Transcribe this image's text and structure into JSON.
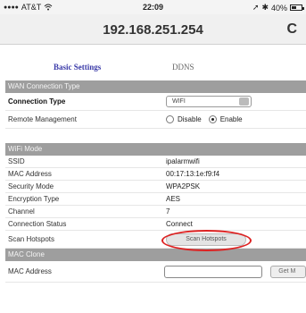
{
  "status_bar": {
    "signal": "●●●●",
    "carrier": "AT&T",
    "wifi_icon": "wifi-icon",
    "time": "22:09",
    "battery": "40%"
  },
  "address_bar": {
    "url": "192.168.251.254",
    "reload_icon": "reload-icon"
  },
  "tabs": [
    {
      "label": "Basic Settings"
    },
    {
      "label": "DDNS"
    }
  ],
  "wan": {
    "section_title": "WAN Connection Type",
    "connection_type_label": "Connection Type",
    "connection_type_value": "WIFI",
    "remote_label": "Remote Management",
    "remote_options": [
      "Disable",
      "Enable"
    ],
    "remote_selected": "Enable"
  },
  "wifi": {
    "section_title": "WiFi Mode",
    "rows": [
      {
        "label": "SSID",
        "value": "ipalarmwifi"
      },
      {
        "label": "MAC Address",
        "value": "00:17:13:1e:f9:f4"
      },
      {
        "label": "Security Mode",
        "value": "WPA2PSK"
      },
      {
        "label": "Encryption Type",
        "value": "AES"
      },
      {
        "label": "Channel",
        "value": "7"
      },
      {
        "label": "Connection Status",
        "value": "Connect"
      }
    ],
    "scan_label": "Scan Hotspots",
    "scan_button": "Scan Hotspots"
  },
  "mac_clone": {
    "section_title": "MAC Clone",
    "label": "MAC Address",
    "input_value": "",
    "get_button": "Get M"
  }
}
